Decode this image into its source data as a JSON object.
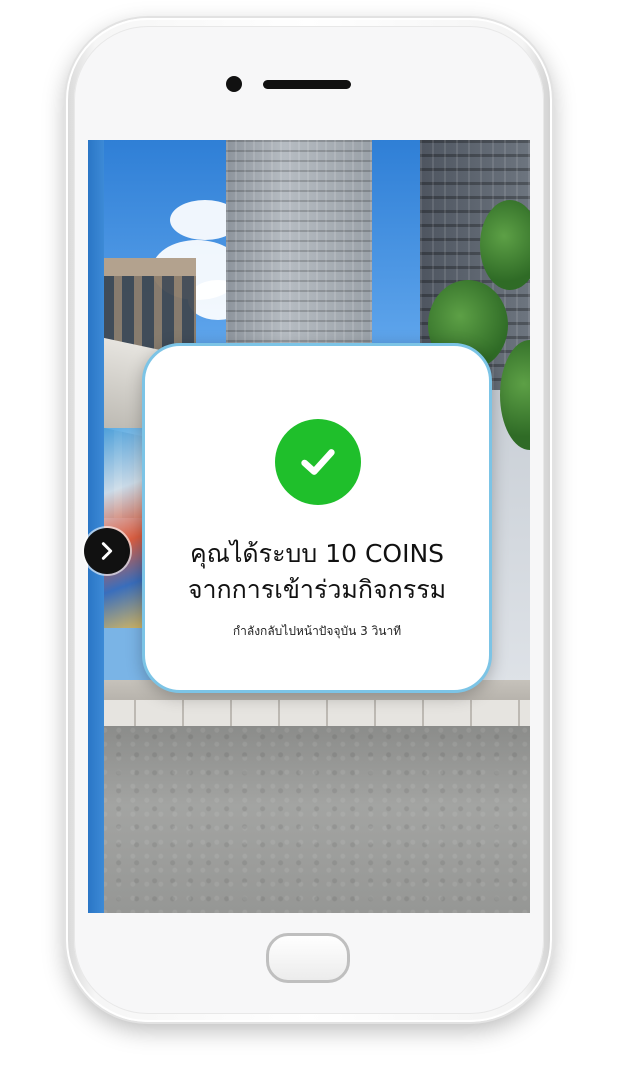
{
  "dialog": {
    "line1": "คุณได้ระบบ 10 COINS",
    "line2": "จากการเข้าร่วมกิจกรรม",
    "countdown": "กำลังกลับไปหน้าปัจจุบัน 3 วินาที",
    "status_icon": "check-circle-icon",
    "status_color": "#1fbf2b",
    "border_color": "#7cc4e6"
  },
  "navigation": {
    "next_icon": "chevron-right-icon"
  }
}
